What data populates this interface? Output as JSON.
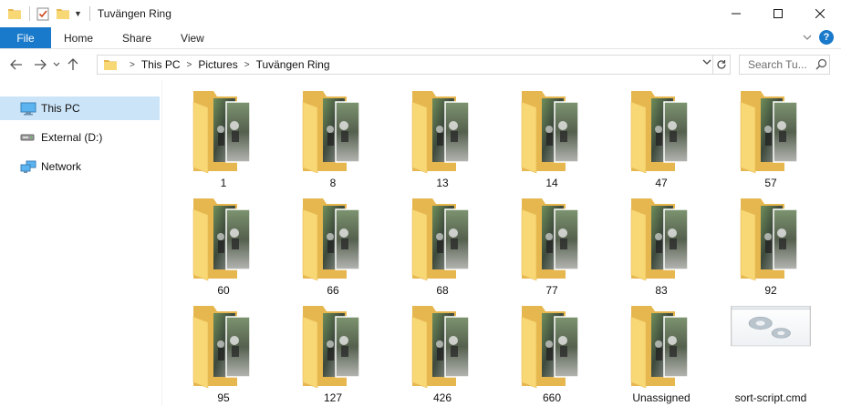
{
  "window": {
    "title": "Tuvängen Ring",
    "controls": {
      "minimize": "—",
      "maximize": "☐",
      "close": "✕"
    }
  },
  "ribbon": {
    "tabs": [
      "File",
      "Home",
      "Share",
      "View"
    ],
    "expand_glyph": "⌄",
    "help": "?"
  },
  "address": {
    "crumbs": [
      "This PC",
      "Pictures",
      "Tuvängen Ring"
    ]
  },
  "search": {
    "placeholder": "Search Tu..."
  },
  "sidebar": {
    "items": [
      {
        "label": "This PC",
        "icon": "computer-icon",
        "selected": true
      },
      {
        "label": "External (D:)",
        "icon": "drive-icon",
        "selected": false
      },
      {
        "label": "Network",
        "icon": "network-icon",
        "selected": false
      }
    ]
  },
  "files": [
    {
      "name": "1",
      "type": "folder"
    },
    {
      "name": "8",
      "type": "folder"
    },
    {
      "name": "13",
      "type": "folder"
    },
    {
      "name": "14",
      "type": "folder"
    },
    {
      "name": "47",
      "type": "folder"
    },
    {
      "name": "57",
      "type": "folder"
    },
    {
      "name": "60",
      "type": "folder"
    },
    {
      "name": "66",
      "type": "folder"
    },
    {
      "name": "68",
      "type": "folder"
    },
    {
      "name": "77",
      "type": "folder"
    },
    {
      "name": "83",
      "type": "folder"
    },
    {
      "name": "92",
      "type": "folder"
    },
    {
      "name": "95",
      "type": "folder"
    },
    {
      "name": "127",
      "type": "folder"
    },
    {
      "name": "426",
      "type": "folder"
    },
    {
      "name": "660",
      "type": "folder"
    },
    {
      "name": "Unassigned",
      "type": "folder"
    },
    {
      "name": "sort-script.cmd",
      "type": "cmd-file"
    }
  ],
  "colors": {
    "accent": "#1979ca",
    "selection": "#cce4f7",
    "folder_back": "#e6b64f",
    "folder_front": "#f8d775"
  }
}
